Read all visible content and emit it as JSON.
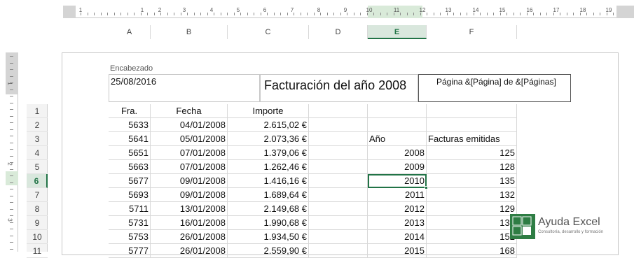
{
  "ruler": {
    "numbers": [
      "1",
      "1",
      "2",
      "3",
      "4",
      "5",
      "6",
      "7",
      "8",
      "9",
      "10",
      "11",
      "12",
      "13",
      "14",
      "15",
      "16",
      "17",
      "18",
      "19"
    ],
    "vnumbers": [
      "1",
      "2",
      "3"
    ]
  },
  "columns": [
    "A",
    "B",
    "C",
    "D",
    "E",
    "F"
  ],
  "selected_column": "E",
  "header": {
    "label": "Encabezado",
    "left": "25/08/2016",
    "center": "Facturación del año 2008",
    "right": "Página &[Página] de &[Páginas]"
  },
  "rows": [
    "1",
    "2",
    "3",
    "4",
    "5",
    "6",
    "7",
    "8",
    "9",
    "10",
    "11"
  ],
  "selected_row": "6",
  "table": {
    "headers": {
      "fra": "Fra.",
      "fecha": "Fecha",
      "importe": "Importe"
    },
    "data": [
      {
        "fra": "5633",
        "fecha": "04/01/2008",
        "importe": "2.615,02 €"
      },
      {
        "fra": "5641",
        "fecha": "05/01/2008",
        "importe": "2.073,36 €"
      },
      {
        "fra": "5651",
        "fecha": "07/01/2008",
        "importe": "1.379,06 €"
      },
      {
        "fra": "5663",
        "fecha": "07/01/2008",
        "importe": "1.262,46 €"
      },
      {
        "fra": "5677",
        "fecha": "09/01/2008",
        "importe": "1.416,16 €"
      },
      {
        "fra": "5693",
        "fecha": "09/01/2008",
        "importe": "1.689,64 €"
      },
      {
        "fra": "5711",
        "fecha": "13/01/2008",
        "importe": "2.149,68 €"
      },
      {
        "fra": "5731",
        "fecha": "16/01/2008",
        "importe": "1.990,68 €"
      },
      {
        "fra": "5753",
        "fecha": "26/01/2008",
        "importe": "1.934,50 €"
      },
      {
        "fra": "5777",
        "fecha": "26/01/2008",
        "importe": "2.559,90 €"
      }
    ]
  },
  "summary": {
    "headers": {
      "year": "Año",
      "count": "Facturas emitidas"
    },
    "data": [
      {
        "year": "2008",
        "count": "125"
      },
      {
        "year": "2009",
        "count": "128"
      },
      {
        "year": "2010",
        "count": "135"
      },
      {
        "year": "2011",
        "count": "132"
      },
      {
        "year": "2012",
        "count": "129"
      },
      {
        "year": "2013",
        "count": "134"
      },
      {
        "year": "2014",
        "count": "152"
      },
      {
        "year": "2015",
        "count": "168"
      }
    ]
  },
  "logo": {
    "title": "Ayuda Excel",
    "subtitle": "Consultoría, desarrollo y formación"
  },
  "colors": {
    "accent": "#217346",
    "grid": "#d8d8d8"
  }
}
